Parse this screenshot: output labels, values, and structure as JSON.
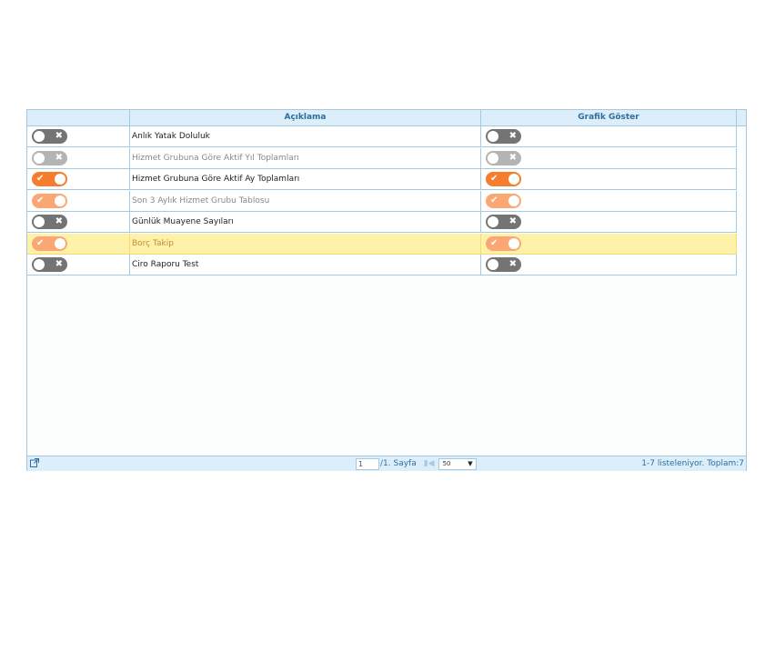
{
  "grid": {
    "columns": [
      {
        "label": ""
      },
      {
        "label": "Açıklama"
      },
      {
        "label": "Grafik Göster"
      }
    ],
    "rows": [
      {
        "description": "Anlık Yatak Doluluk",
        "active": false,
        "grafik": false
      },
      {
        "description": "Hizmet Grubuna Göre Aktif Yıl Toplamları",
        "active": false,
        "grafik": false
      },
      {
        "description": "Hizmet Grubuna Göre Aktif Ay Toplamları",
        "active": true,
        "grafik": true
      },
      {
        "description": "Son 3 Aylık Hizmet Grubu Tablosu",
        "active": true,
        "grafik": true
      },
      {
        "description": "Günlük Muayene Sayıları",
        "active": false,
        "grafik": false
      },
      {
        "description": "Borç Takip",
        "active": true,
        "grafik": true,
        "selected": true
      },
      {
        "description": "Ciro Raporu Test",
        "active": false,
        "grafik": false
      }
    ]
  },
  "footer": {
    "export_icon": "external-link-icon",
    "page_input": "1",
    "page_of": "/1. Sayfa",
    "last_page_icon": "last-page-icon",
    "page_size": "50",
    "record_info": "1-7 listeleniyor. Toplam:7"
  },
  "colors": {
    "toggle_on": "#f77d2e",
    "toggle_off": "#747474",
    "highlight": "#fdf2a8",
    "header_bg": "#ddeefb",
    "border": "#a6c9e2"
  }
}
